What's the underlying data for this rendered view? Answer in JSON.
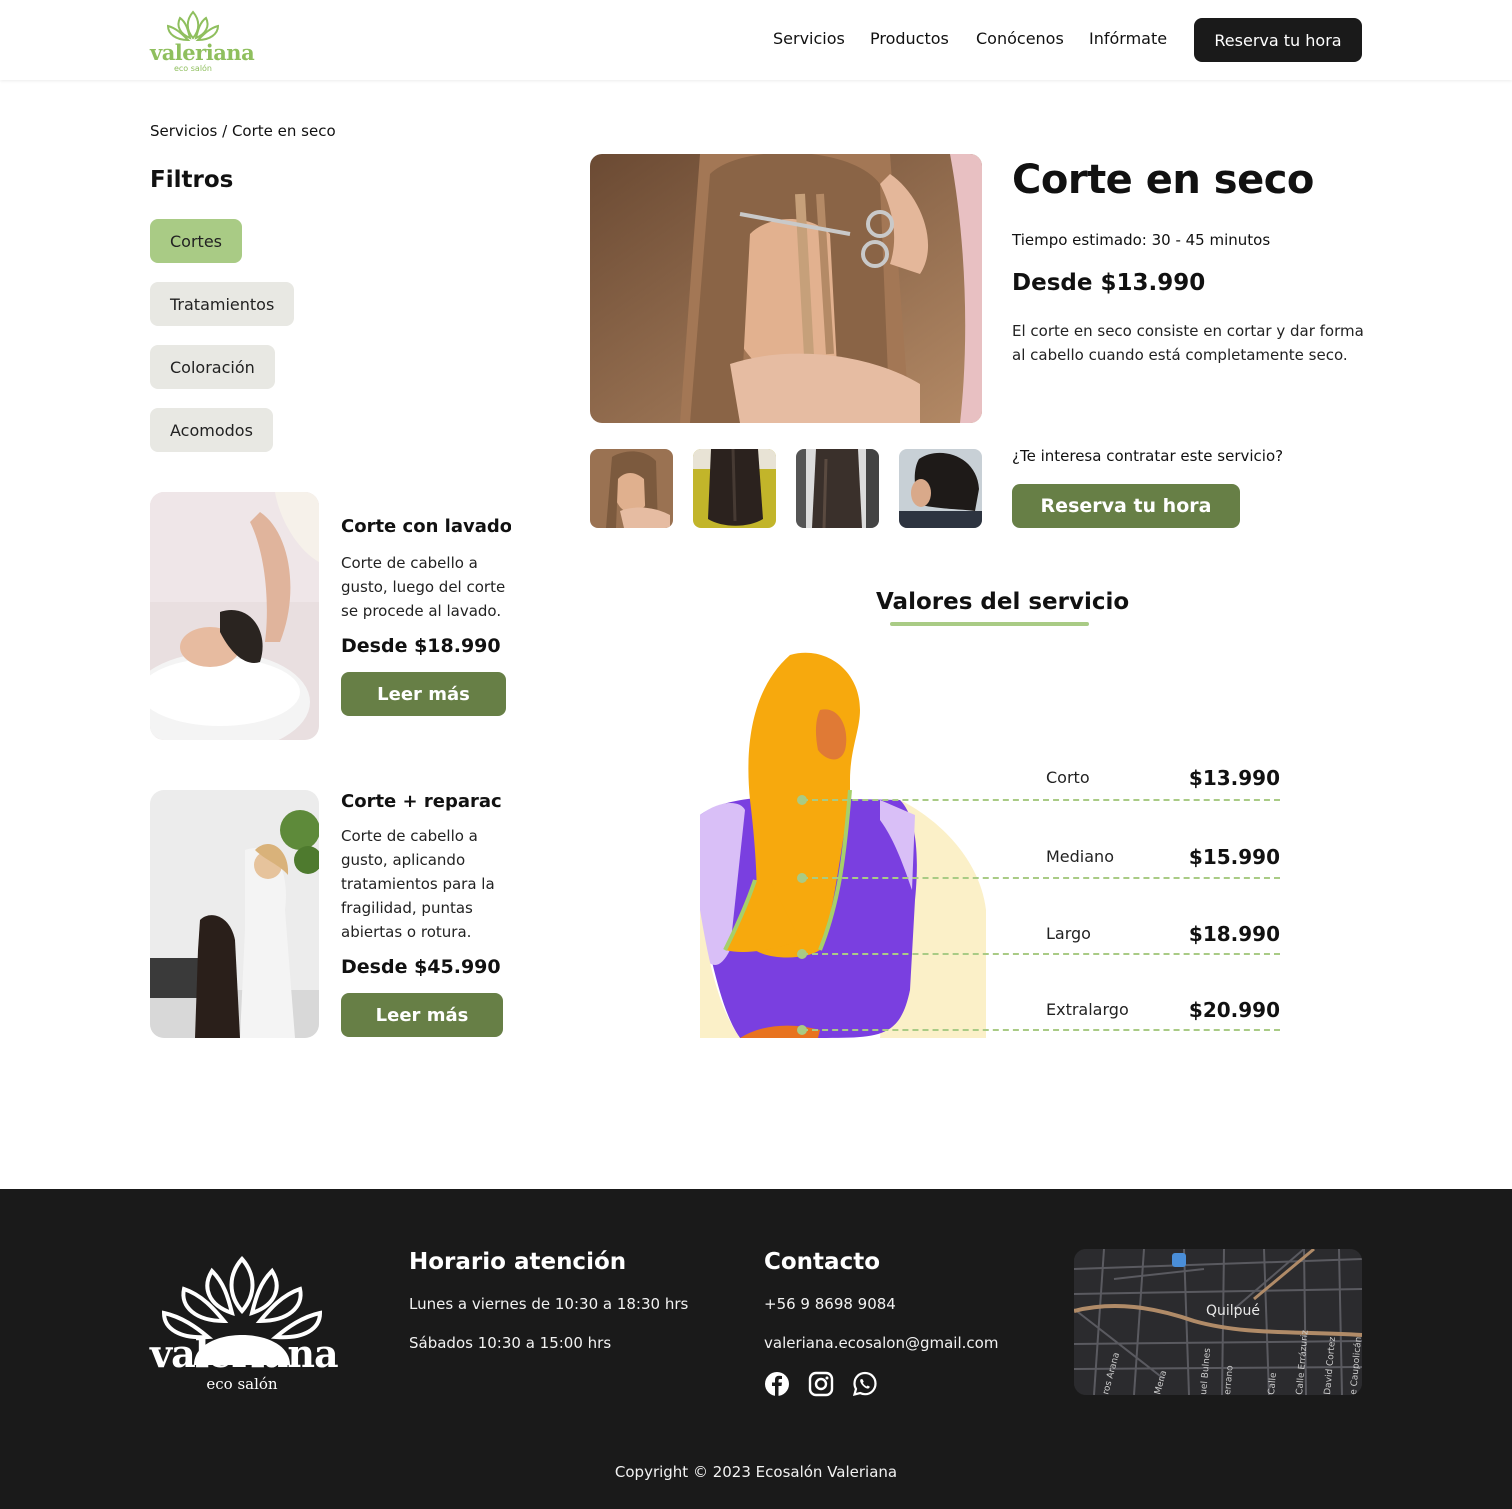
{
  "header": {
    "logo_text": "valeriana",
    "logo_sub": "eco salón",
    "nav": [
      "Servicios",
      "Productos",
      "Conócenos",
      "Infórmate"
    ],
    "cta": "Reserva tu hora"
  },
  "breadcrumb": "Servicios / Corte en seco",
  "filters": {
    "title": "Filtros",
    "items": [
      "Cortes",
      "Tratamientos",
      "Coloración",
      "Acomodos"
    ],
    "active": "Cortes"
  },
  "related": [
    {
      "title": "Corte con lavado",
      "description": "Corte de cabello a gusto, luego del corte se  procede al lavado.",
      "price": "Desde $18.990",
      "button": "Leer más"
    },
    {
      "title": "Corte + reparación",
      "description": "Corte de cabello a gusto, aplicando tratamientos para la fragilidad, puntas abiertas o rotura.",
      "price": "Desde $45.990",
      "button": "Leer más"
    }
  ],
  "detail": {
    "title": "Corte en seco",
    "time": "Tiempo estimado: 30 - 45 minutos",
    "price": "Desde $13.990",
    "description": "El corte en seco consiste en cortar y dar forma al  cabello cuando está completamente seco.",
    "question": "¿Te interesa contratar este servicio?",
    "cta": "Reserva tu hora"
  },
  "values": {
    "title": "Valores del servicio",
    "rows": [
      {
        "label": "Corto",
        "price": "$13.990"
      },
      {
        "label": "Mediano",
        "price": "$15.990"
      },
      {
        "label": "Largo",
        "price": "$18.990"
      },
      {
        "label": "Extralargo",
        "price": "$20.990"
      }
    ]
  },
  "footer": {
    "logo_text": "valeriana",
    "logo_sub": "eco salón",
    "hours_title": "Horario atención",
    "hours": [
      "Lunes a viernes de 10:30 a 18:30 hrs",
      "Sábados 10:30 a 15:00 hrs"
    ],
    "contact_title": "Contacto",
    "phone": "+56 9 8698 9084",
    "email": "valeriana.ecosalon@gmail.com",
    "social_icons": [
      "facebook-icon",
      "instagram-icon",
      "whatsapp-icon"
    ],
    "map": {
      "city": "Quilpué",
      "streets": [
        "ros Arana",
        "Mena",
        "uel Bulnes",
        "errano",
        "Calle",
        "Calle Errázuriz",
        "David Cortez",
        "e Caupolicán"
      ]
    },
    "copyright": "Copyright © 2023 Ecosalón Valeriana"
  },
  "colors": {
    "accent_green": "#a9cb85",
    "button_green": "#677f46",
    "dark": "#1a1a1a",
    "chip_bg": "#e8e8e3"
  }
}
